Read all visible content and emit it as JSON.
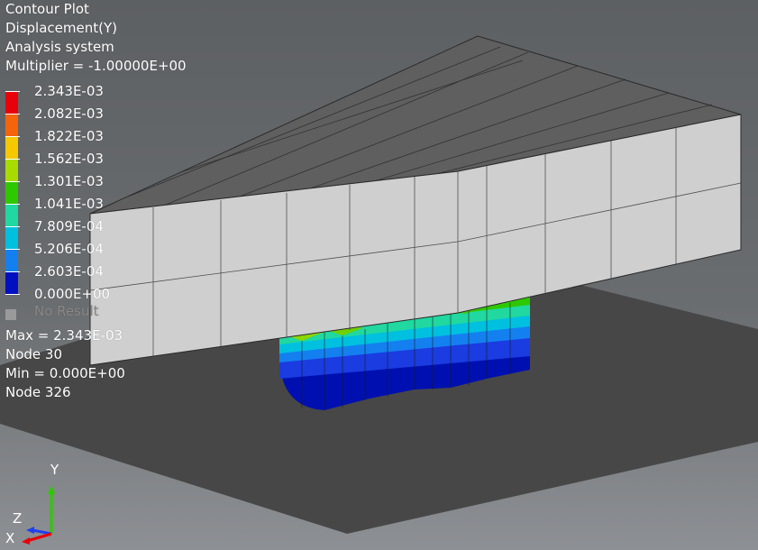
{
  "header": {
    "plot_type": "Contour Plot",
    "result": "Displacement(Y)",
    "system": "Analysis system",
    "multiplier": "Multiplier = -1.00000E+00"
  },
  "legend": {
    "labels": [
      "2.343E-03",
      "2.082E-03",
      "1.822E-03",
      "1.562E-03",
      "1.301E-03",
      "1.041E-03",
      "7.809E-04",
      "5.206E-04",
      "2.603E-04",
      "0.000E+00"
    ],
    "colors": [
      "#e8000a",
      "#f5640a",
      "#f5c800",
      "#a8dc00",
      "#2ec800",
      "#20d8a0",
      "#00c0e0",
      "#1480f0",
      "#0010c0"
    ],
    "no_result": "No Result",
    "no_result_color": "#9a9a9a"
  },
  "info": {
    "max": "Max =  2.343E-03",
    "max_node": "Node 30",
    "min": "Min =  0.000E+00",
    "min_node": "Node 326"
  },
  "triad": {
    "y": "Y",
    "z": "Z",
    "x": "X"
  },
  "colors": {
    "background_top": "#5d6063",
    "background_bottom": "#8d9094",
    "floor": "#4a4a4a",
    "plate_top": "#5f5f5f",
    "plate_side": "#d0d0d0"
  }
}
